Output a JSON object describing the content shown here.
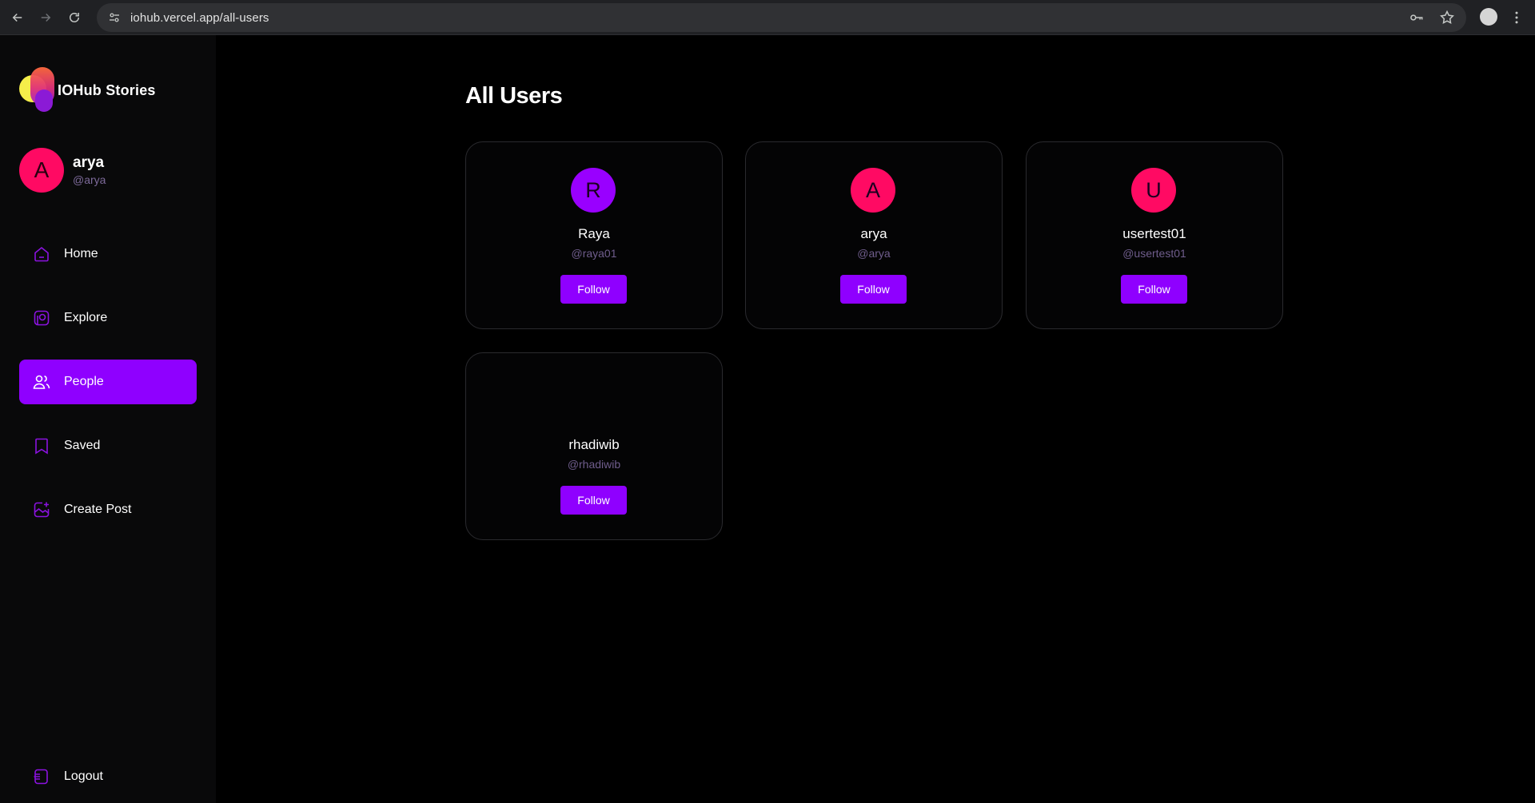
{
  "browser": {
    "url": "iohub.vercel.app/all-users",
    "icons": [
      "back-arrow-icon",
      "forward-arrow-icon",
      "reload-icon",
      "site-info-icon",
      "password-key-icon",
      "bookmark-star-icon",
      "profile-avatar",
      "more-menu-icon"
    ]
  },
  "brand": {
    "name": "IOHub Stories"
  },
  "current_user": {
    "initial": "A",
    "name": "arya",
    "handle": "@arya",
    "color": "#ff0a63"
  },
  "sidebar": {
    "items": [
      {
        "label": "Home",
        "icon": "home-icon",
        "active": false
      },
      {
        "label": "Explore",
        "icon": "explore-icon",
        "active": false
      },
      {
        "label": "People",
        "icon": "people-icon",
        "active": true
      },
      {
        "label": "Saved",
        "icon": "bookmark-icon",
        "active": false
      },
      {
        "label": "Create Post",
        "icon": "create-post-icon",
        "active": false
      }
    ],
    "logout_label": "Logout",
    "accent": "#8f00ff"
  },
  "main": {
    "title": "All Users",
    "users": [
      {
        "initial": "R",
        "name": "Raya",
        "handle": "@raya01",
        "avatar_color": "#9900ff",
        "follow_label": "Follow"
      },
      {
        "initial": "A",
        "name": "arya",
        "handle": "@arya",
        "avatar_color": "#ff0a63",
        "follow_label": "Follow"
      },
      {
        "initial": "U",
        "name": "usertest01",
        "handle": "@usertest01",
        "avatar_color": "#ff0a63",
        "follow_label": "Follow"
      },
      {
        "initial": "",
        "name": "rhadiwib",
        "handle": "@rhadiwib",
        "avatar_color": "",
        "follow_label": "Follow"
      }
    ]
  }
}
